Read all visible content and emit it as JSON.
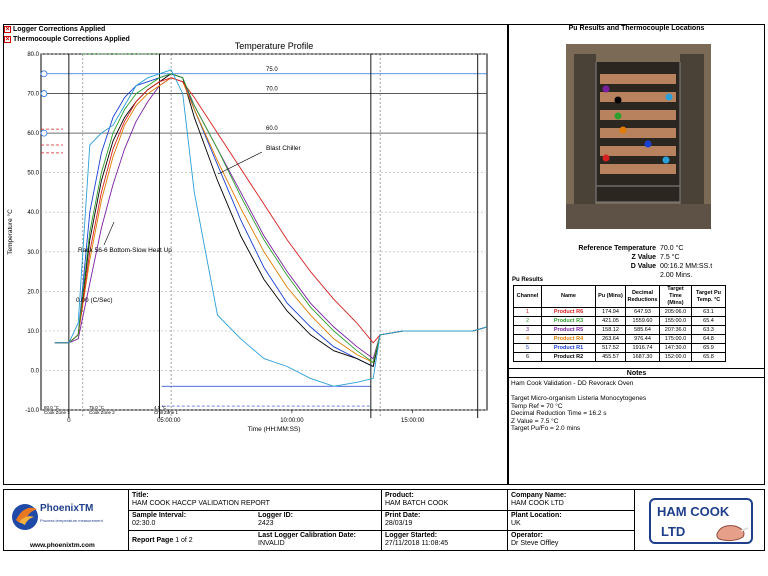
{
  "legend_flags": [
    {
      "label": "Logger Corrections Applied"
    },
    {
      "label": "Thermocouple Corrections Applied"
    }
  ],
  "chart_data": {
    "type": "line",
    "title": "Temperature Profile",
    "xlabel": "Time (HH:MM:SS)",
    "ylabel": "Temperature °C",
    "ylim": [
      -10,
      80
    ],
    "yticks": [
      "-10.0",
      "0.0",
      "10.0",
      "20.0",
      "30.0",
      "40.0",
      "50.0",
      "60.0",
      "70.0",
      "80.0"
    ],
    "xticks": [
      "0",
      "05:00:00",
      "10:00:00",
      "15:00:00"
    ],
    "reference_lines": [
      {
        "value": 75.0,
        "label": "75.0"
      },
      {
        "value": 70.0,
        "label": "70.0"
      },
      {
        "value": 60.0,
        "label": "60.0"
      }
    ],
    "annotations": [
      {
        "text": "Blast Chiller"
      },
      {
        "text": "Rack 56-6 Bottom-Slow Heat Up"
      },
      {
        "text": "0.00 (C/Sec)"
      }
    ],
    "zones": [
      {
        "temp": "60.0 °C",
        "name": "Cook Zone 1"
      },
      {
        "temp": "75.0 °C",
        "name": "Cook Zone 2"
      },
      {
        "temp": "4.0 °C",
        "name": "Chill Zone 1"
      }
    ],
    "x": [
      0,
      0.6,
      1.0,
      1.5,
      2.0,
      2.5,
      3.0,
      3.5,
      4.0,
      4.5,
      5.0,
      5.5,
      6.0,
      7.0,
      8.0,
      9.0,
      10.0,
      11.0,
      12.0,
      13.0,
      13.7,
      14.0,
      15.0,
      16.0,
      17.0,
      18.0,
      18.6
    ],
    "series": [
      {
        "color": "#1a3fd4",
        "values": [
          7,
          7,
          9,
          40,
          55,
          64,
          69,
          72,
          73,
          74,
          75,
          74,
          66,
          52,
          38,
          26,
          17,
          11,
          6,
          3,
          1,
          9,
          10,
          10,
          10,
          10,
          11
        ]
      },
      {
        "color": "#000000",
        "values": [
          7,
          7,
          9,
          33,
          48,
          58,
          64,
          68,
          71,
          73,
          75,
          74,
          64,
          48,
          34,
          23,
          15,
          9,
          5,
          3,
          1,
          9,
          10,
          10,
          10,
          10,
          11
        ]
      },
      {
        "color": "#7b1fa2",
        "values": [
          7,
          7,
          8,
          22,
          36,
          47,
          56,
          63,
          68,
          72,
          74,
          73,
          67,
          56,
          45,
          34,
          25,
          17,
          11,
          6,
          3,
          9,
          10,
          10,
          10,
          10,
          11
        ]
      },
      {
        "color": "#e07b00",
        "values": [
          7,
          7,
          9,
          28,
          43,
          54,
          62,
          67,
          70,
          72,
          74,
          73,
          66,
          53,
          41,
          30,
          21,
          14,
          8,
          4,
          2,
          9,
          10,
          10,
          10,
          10,
          11
        ]
      },
      {
        "color": "#d62020",
        "values": [
          7,
          7,
          9,
          30,
          45,
          56,
          63,
          68,
          71,
          73,
          74,
          73,
          69,
          60,
          51,
          42,
          33,
          25,
          18,
          12,
          7,
          9,
          10,
          10,
          10,
          10,
          11
        ]
      },
      {
        "color": "#2e9e2e",
        "values": [
          7,
          7,
          9,
          35,
          50,
          60,
          66,
          70,
          72,
          74,
          75,
          74,
          67,
          56,
          44,
          33,
          24,
          16,
          10,
          5,
          2,
          9,
          10,
          10,
          10,
          10,
          11
        ]
      },
      {
        "color": "#2a9fd8",
        "values": [
          7,
          7,
          12,
          57,
          60,
          62,
          67,
          72,
          74,
          75,
          76,
          70,
          45,
          14,
          8,
          3,
          1,
          -2,
          -4,
          -3,
          -2,
          9,
          10,
          10,
          10,
          10,
          11
        ]
      }
    ]
  },
  "right": {
    "photo_title": "Pu Results and Thermocouple Locations",
    "ref_rows": [
      {
        "k": "Reference Temperature",
        "v": "70.0 °C"
      },
      {
        "k": "Z Value",
        "v": "7.5 °C"
      },
      {
        "k": "D Value",
        "v": "00:16.2 MM:SS.t"
      },
      {
        "k": "",
        "v": "2.00 Mins."
      }
    ],
    "pu_label": "Pu Results",
    "table_headers": [
      "Channel",
      "Name",
      "Pu (Mins)",
      "Decimal Reductions",
      "Target Time (Mins)",
      "Target Pu Temp. °C"
    ],
    "rows": [
      {
        "ch": "1",
        "name": "Product R6",
        "color": "#d62020",
        "pu": "174.94",
        "dec": "647.93",
        "tt": "205:06.0",
        "tpu": "63.1"
      },
      {
        "ch": "2",
        "name": "Product R3",
        "color": "#2e9e2e",
        "pu": "421.05",
        "dec": "1559.60",
        "tt": "155:00.0",
        "tpu": "65.4"
      },
      {
        "ch": "3",
        "name": "Product R5",
        "color": "#7b1fa2",
        "pu": "158.12",
        "dec": "585.64",
        "tt": "207:36.0",
        "tpu": "63.3"
      },
      {
        "ch": "4",
        "name": "Product R4",
        "color": "#e07b00",
        "pu": "263.64",
        "dec": "976.44",
        "tt": "175:00.0",
        "tpu": "64.8"
      },
      {
        "ch": "5",
        "name": "Product R1",
        "color": "#1a3fd4",
        "pu": "517.52",
        "dec": "1916.74",
        "tt": "147:30.0",
        "tpu": "65.9"
      },
      {
        "ch": "6",
        "name": "Product R2",
        "color": "#000000",
        "pu": "455.57",
        "dec": "1687.30",
        "tt": "152:00.0",
        "tpu": "65.8"
      }
    ],
    "notes_title": "Notes",
    "notes": [
      "Ham Cook Validation - DD Revorack Oven",
      "",
      "Target Micro-organism Listeria Monocytogenes",
      "Temp Ref = 70 °C",
      "Decimal Reduction Time = 16.2 s",
      "Z Value = 7.5 °C",
      "Target Pu/Fo = 2.0 mins"
    ]
  },
  "footer": {
    "brand": "PhoenixTM",
    "brand_sub": "Process temperature measurement",
    "website": "www.phoenixtm.com",
    "title_label": "Title:",
    "title": "HAM COOK HACCP VALIDATION REPORT",
    "product_label": "Product:",
    "product": "HAM BATCH COOK",
    "company_label": "Company Name:",
    "company": "HAM COOK LTD",
    "interval_label": "Sample Interval:",
    "interval": "02:30.0",
    "logger_label": "Logger ID:",
    "logger": "2423",
    "print_label": "Print Date:",
    "print": "28/03/19",
    "plant_label": "Plant Location:",
    "plant": "UK",
    "page_label": "Report Page",
    "page": "1 of 2",
    "calib_label": "Last Logger Calibration Date:",
    "calib": "INVALID",
    "started_label": "Logger Started:",
    "started": "27/11/2018 11:08:45",
    "operator_label": "Operator:",
    "operator": "Dr Steve Offley",
    "logo_line1": "HAM COOK",
    "logo_line2": "LTD"
  }
}
